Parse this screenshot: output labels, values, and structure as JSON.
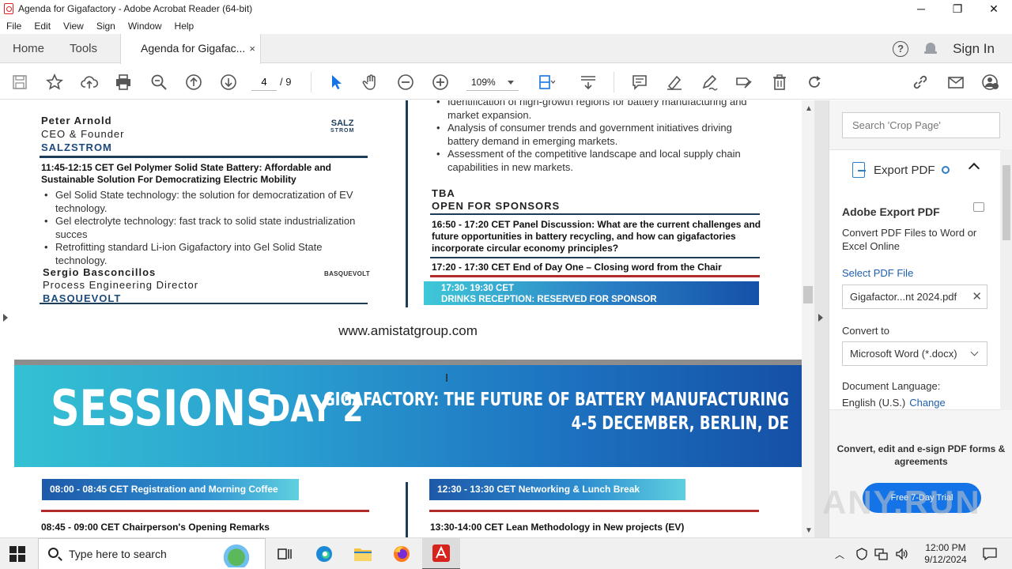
{
  "window": {
    "title": "Agenda for Gigafactory - Adobe Acrobat Reader (64-bit)",
    "minimize": "─",
    "maximize": "❐",
    "close": "✕"
  },
  "menu": [
    "File",
    "Edit",
    "View",
    "Sign",
    "Window",
    "Help"
  ],
  "tabs": {
    "home": "Home",
    "tools": "Tools",
    "document": "Agenda for Gigafac...",
    "close": "×",
    "help": "?",
    "sign_in": "Sign In"
  },
  "toolbar": {
    "current_page": "4",
    "total_pages": "/ 9",
    "zoom": "109%"
  },
  "page": {
    "left": {
      "speaker1_name": "Peter Arnold",
      "speaker1_role": "CEO & Founder",
      "speaker1_company": "SALZSTROM",
      "logo1_main": "SALZ",
      "logo1_sub": "STROM",
      "session_title": "11:45-12:15 CET Gel Polymer Solid State Battery: Affordable and Sustainable Solution For Democratizing Electric Mobility",
      "bullets": [
        "Gel Solid State technology: the solution for democratization of EV technology.",
        "Gel electrolyte technology: fast track to solid state industrialization succes",
        "Retrofitting standard Li-ion Gigafactory into Gel Solid State technology."
      ],
      "speaker2_name": "Sergio Basconcillos",
      "speaker2_role": "Process Engineering Director",
      "speaker2_company": "BASQUEVOLT",
      "logo2": "BASQUEVOLT"
    },
    "right": {
      "bullets": [
        "Identification of high-growth regions for battery manufacturing and market expansion.",
        "Analysis of consumer trends and government initiatives driving battery demand in emerging markets.",
        "Assessment of the competitive landscape and local supply chain capabilities in new markets."
      ],
      "tba": "TBA",
      "sponsors": "OPEN FOR SPONSORS",
      "panel": "16:50 - 17:20 CET Panel Discussion: What are the current challenges and future opportunities in battery recycling, and how can gigafactories incorporate circular economy principles?",
      "end_day": "17:20 - 17:30 CET End of Day One – Closing word from the Chair",
      "drinks_time": "17:30- 19:30 CET",
      "drinks_label": "DRINKS RECEPTION: RESERVED FOR SPONSOR"
    },
    "site": "www.amistatgroup.com",
    "banner": {
      "sessions": "SESSIONS",
      "day": "DAY 2",
      "tagline1": "GIGAFACTORY: THE FUTURE OF BATTERY MANUFACTURING",
      "tagline2": "4-5 DECEMBER, BERLIN, DE"
    },
    "day2": {
      "pill_left": "08:00 - 08:45 CET Registration and Morning Coffee",
      "pill_right": "12:30 - 13:30 CET Networking & Lunch Break",
      "item_left": "08:45 - 09:00 CET Chairperson's Opening Remarks",
      "item_right": "13:30-14:00 CET Lean Methodology in New projects (EV)"
    }
  },
  "panel": {
    "search_placeholder": "Search 'Crop Page'",
    "export_title": "Export PDF",
    "adobe_export": "Adobe Export PDF",
    "description": "Convert PDF Files to Word or Excel Online",
    "select_file": "Select PDF File",
    "file_name": "Gigafactor...nt 2024.pdf",
    "convert_to_label": "Convert to",
    "convert_to_value": "Microsoft Word (*.docx)",
    "language_label": "Document Language:",
    "language_value": "English (U.S.)",
    "change": "Change",
    "promo": "Convert, edit and e-sign PDF forms & agreements",
    "trial": "Free 7-Day Trial"
  },
  "watermark": "ANY.RUN",
  "taskbar": {
    "search_placeholder": "Type here to search",
    "time": "12:00 PM",
    "date": "9/12/2024"
  }
}
